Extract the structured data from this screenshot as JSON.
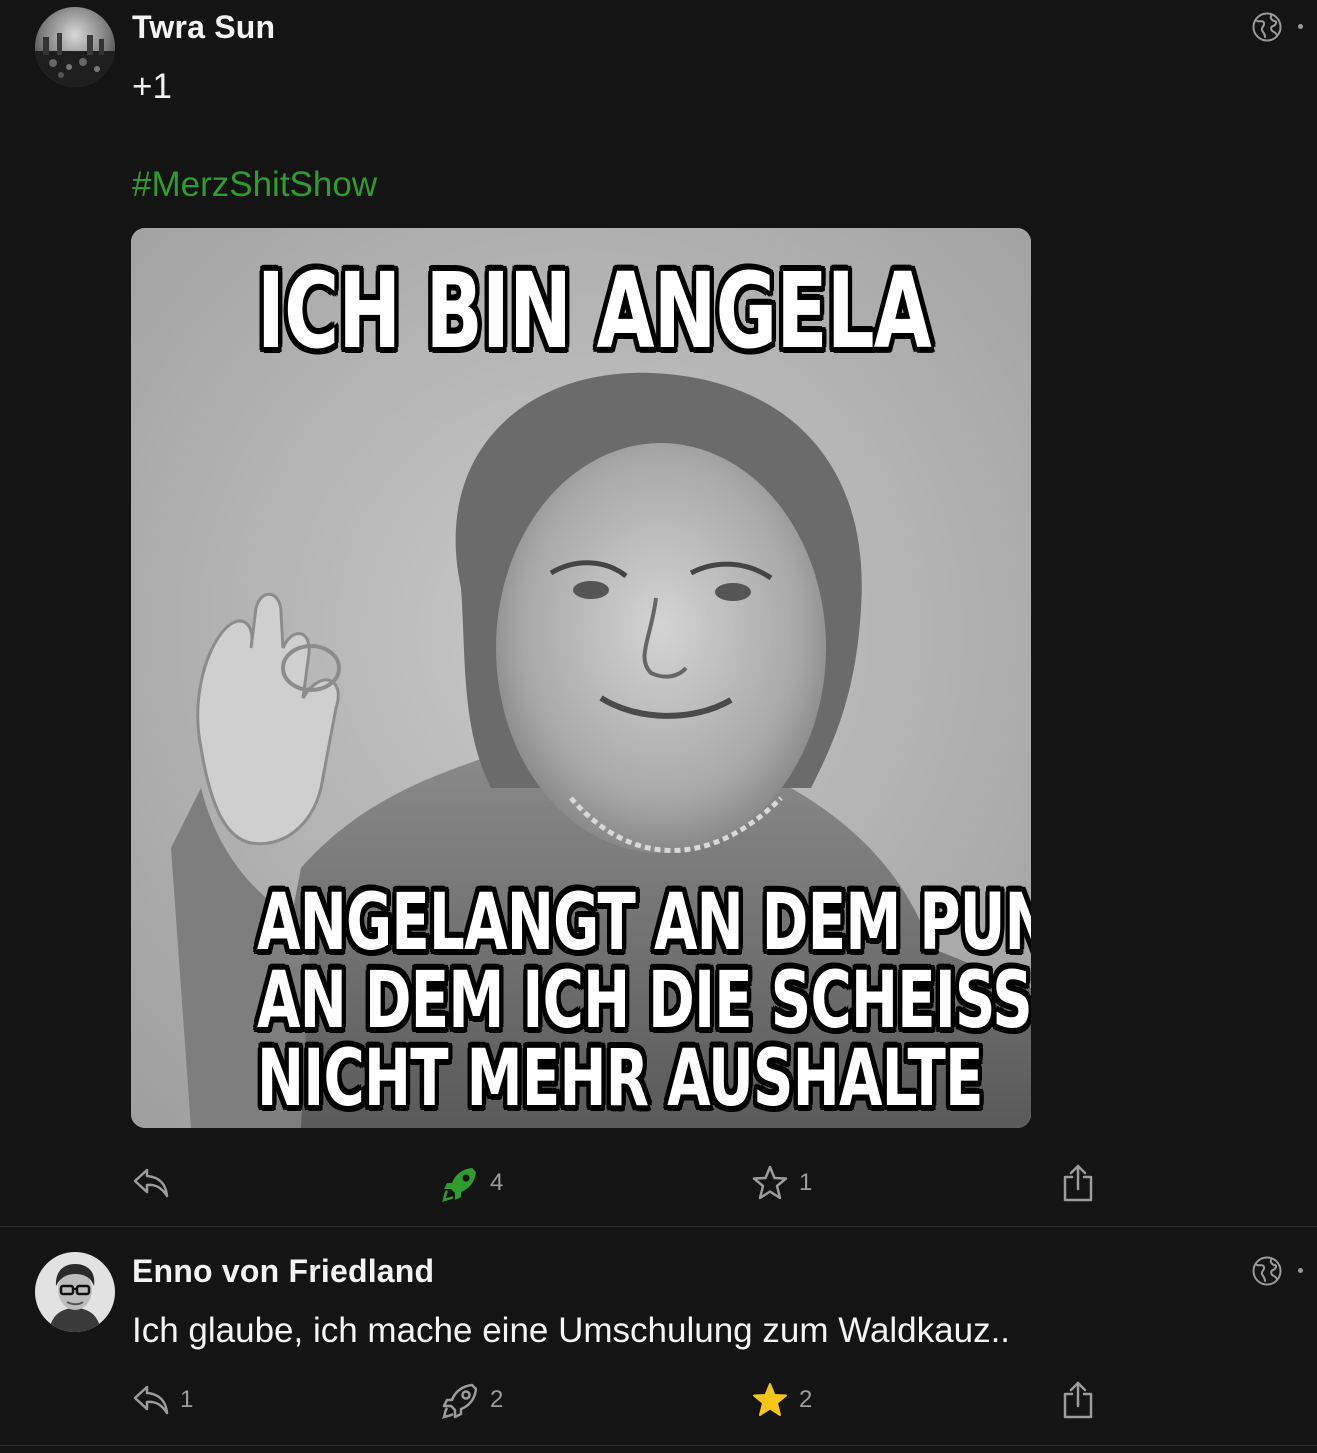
{
  "colors": {
    "background": "#141414",
    "text": "#f4f4f4",
    "muted": "#9c9c9c",
    "hashtag": "#2e9c2e",
    "boost_active": "#2e9c2e",
    "favourite_active": "#f5c518"
  },
  "posts": [
    {
      "author": "Twra Sun",
      "text": "+1",
      "hashtag": "#MerzShitShow",
      "visibility_icon": "globe-icon",
      "media": {
        "meme_top": "ICH BIN ANGELA",
        "meme_bottom_1": "ANGELANGT AN DEM PUNKT,",
        "meme_bottom_2": "AN DEM ICH DIE SCHEISSE",
        "meme_bottom_3": "NICHT MEHR AUSHALTE"
      },
      "actions": {
        "reply_count": "",
        "boost_count": "4",
        "boost_active": true,
        "favourite_count": "1",
        "favourite_active": false
      }
    },
    {
      "author": "Enno von Friedland",
      "text": "Ich glaube, ich mache eine Umschulung zum Waldkauz..",
      "visibility_icon": "globe-icon",
      "actions": {
        "reply_count": "1",
        "boost_count": "2",
        "boost_active": false,
        "favourite_count": "2",
        "favourite_active": true
      }
    }
  ]
}
